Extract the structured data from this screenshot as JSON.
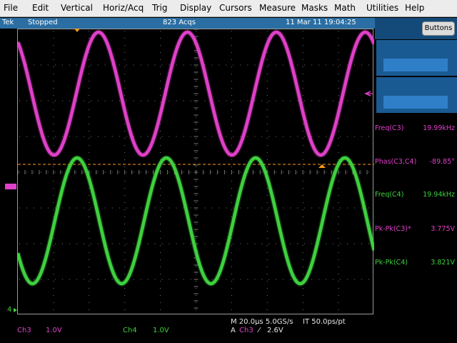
{
  "menu": [
    "File",
    "Edit",
    "Vertical",
    "Horiz/Acq",
    "Trig",
    "Display",
    "Cursors",
    "Measure",
    "Masks",
    "Math",
    "Utilities",
    "Help"
  ],
  "status": {
    "brand": "Tek",
    "state": "Stopped",
    "acqs": "823 Acqs",
    "datetime": "11 Mar 11 19:04:25"
  },
  "panel": {
    "buttons_label": "Buttons",
    "measurements": [
      {
        "label": "Freq(C3)",
        "value": "19.99kHz",
        "color": "#e040c8"
      },
      {
        "label": "Phas(C3,C4)",
        "value": "-89.85°",
        "color": "#e040c8"
      },
      {
        "label": "Freq(C4)",
        "value": "19.94kHz",
        "color": "#3fd13f"
      },
      {
        "label": "Pk-Pk(C3)*",
        "value": "3.775V",
        "color": "#e040c8"
      },
      {
        "label": "Pk-Pk(C4)",
        "value": "3.821V",
        "color": "#3fd13f"
      }
    ]
  },
  "channels": {
    "ch3": {
      "name": "Ch3",
      "scale": "1.0V",
      "color": "#e040c8"
    },
    "ch4": {
      "name": "Ch4",
      "scale": "1.0V",
      "color": "#3fd13f"
    }
  },
  "horizontal": {
    "timebase": "M 20.0µs 5.0GS/s",
    "interp": "IT 50.0ps/pt"
  },
  "trigger": {
    "prefix": "A",
    "source": "Ch3",
    "slope": "⁄",
    "level": "2.6V"
  },
  "markers": {
    "ch4_ref": "4"
  },
  "colors": {
    "trigger_orange": "#ff9a1a",
    "grid": "#7a7a7a",
    "status_bar": "#2a6ea3"
  }
}
